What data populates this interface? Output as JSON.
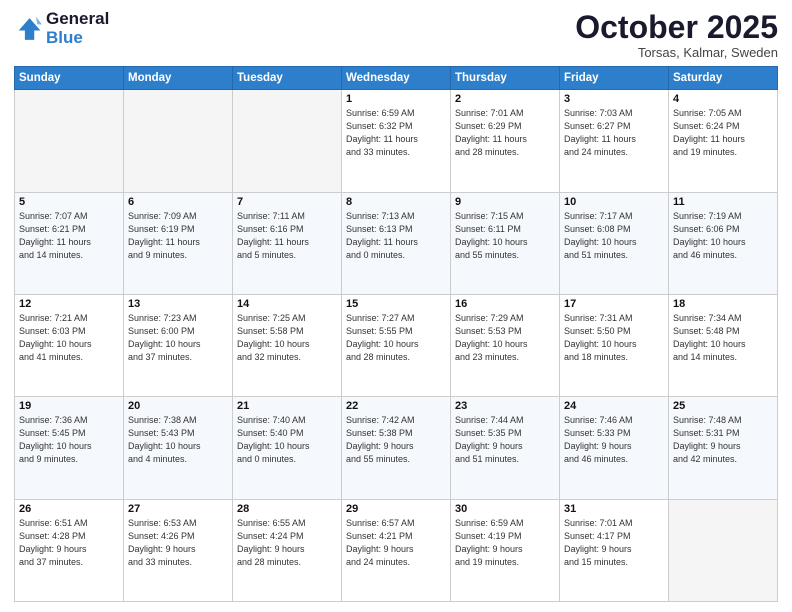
{
  "header": {
    "logo_line1": "General",
    "logo_line2": "Blue",
    "month": "October 2025",
    "location": "Torsas, Kalmar, Sweden"
  },
  "weekdays": [
    "Sunday",
    "Monday",
    "Tuesday",
    "Wednesday",
    "Thursday",
    "Friday",
    "Saturday"
  ],
  "weeks": [
    [
      {
        "day": "",
        "info": ""
      },
      {
        "day": "",
        "info": ""
      },
      {
        "day": "",
        "info": ""
      },
      {
        "day": "1",
        "info": "Sunrise: 6:59 AM\nSunset: 6:32 PM\nDaylight: 11 hours\nand 33 minutes."
      },
      {
        "day": "2",
        "info": "Sunrise: 7:01 AM\nSunset: 6:29 PM\nDaylight: 11 hours\nand 28 minutes."
      },
      {
        "day": "3",
        "info": "Sunrise: 7:03 AM\nSunset: 6:27 PM\nDaylight: 11 hours\nand 24 minutes."
      },
      {
        "day": "4",
        "info": "Sunrise: 7:05 AM\nSunset: 6:24 PM\nDaylight: 11 hours\nand 19 minutes."
      }
    ],
    [
      {
        "day": "5",
        "info": "Sunrise: 7:07 AM\nSunset: 6:21 PM\nDaylight: 11 hours\nand 14 minutes."
      },
      {
        "day": "6",
        "info": "Sunrise: 7:09 AM\nSunset: 6:19 PM\nDaylight: 11 hours\nand 9 minutes."
      },
      {
        "day": "7",
        "info": "Sunrise: 7:11 AM\nSunset: 6:16 PM\nDaylight: 11 hours\nand 5 minutes."
      },
      {
        "day": "8",
        "info": "Sunrise: 7:13 AM\nSunset: 6:13 PM\nDaylight: 11 hours\nand 0 minutes."
      },
      {
        "day": "9",
        "info": "Sunrise: 7:15 AM\nSunset: 6:11 PM\nDaylight: 10 hours\nand 55 minutes."
      },
      {
        "day": "10",
        "info": "Sunrise: 7:17 AM\nSunset: 6:08 PM\nDaylight: 10 hours\nand 51 minutes."
      },
      {
        "day": "11",
        "info": "Sunrise: 7:19 AM\nSunset: 6:06 PM\nDaylight: 10 hours\nand 46 minutes."
      }
    ],
    [
      {
        "day": "12",
        "info": "Sunrise: 7:21 AM\nSunset: 6:03 PM\nDaylight: 10 hours\nand 41 minutes."
      },
      {
        "day": "13",
        "info": "Sunrise: 7:23 AM\nSunset: 6:00 PM\nDaylight: 10 hours\nand 37 minutes."
      },
      {
        "day": "14",
        "info": "Sunrise: 7:25 AM\nSunset: 5:58 PM\nDaylight: 10 hours\nand 32 minutes."
      },
      {
        "day": "15",
        "info": "Sunrise: 7:27 AM\nSunset: 5:55 PM\nDaylight: 10 hours\nand 28 minutes."
      },
      {
        "day": "16",
        "info": "Sunrise: 7:29 AM\nSunset: 5:53 PM\nDaylight: 10 hours\nand 23 minutes."
      },
      {
        "day": "17",
        "info": "Sunrise: 7:31 AM\nSunset: 5:50 PM\nDaylight: 10 hours\nand 18 minutes."
      },
      {
        "day": "18",
        "info": "Sunrise: 7:34 AM\nSunset: 5:48 PM\nDaylight: 10 hours\nand 14 minutes."
      }
    ],
    [
      {
        "day": "19",
        "info": "Sunrise: 7:36 AM\nSunset: 5:45 PM\nDaylight: 10 hours\nand 9 minutes."
      },
      {
        "day": "20",
        "info": "Sunrise: 7:38 AM\nSunset: 5:43 PM\nDaylight: 10 hours\nand 4 minutes."
      },
      {
        "day": "21",
        "info": "Sunrise: 7:40 AM\nSunset: 5:40 PM\nDaylight: 10 hours\nand 0 minutes."
      },
      {
        "day": "22",
        "info": "Sunrise: 7:42 AM\nSunset: 5:38 PM\nDaylight: 9 hours\nand 55 minutes."
      },
      {
        "day": "23",
        "info": "Sunrise: 7:44 AM\nSunset: 5:35 PM\nDaylight: 9 hours\nand 51 minutes."
      },
      {
        "day": "24",
        "info": "Sunrise: 7:46 AM\nSunset: 5:33 PM\nDaylight: 9 hours\nand 46 minutes."
      },
      {
        "day": "25",
        "info": "Sunrise: 7:48 AM\nSunset: 5:31 PM\nDaylight: 9 hours\nand 42 minutes."
      }
    ],
    [
      {
        "day": "26",
        "info": "Sunrise: 6:51 AM\nSunset: 4:28 PM\nDaylight: 9 hours\nand 37 minutes."
      },
      {
        "day": "27",
        "info": "Sunrise: 6:53 AM\nSunset: 4:26 PM\nDaylight: 9 hours\nand 33 minutes."
      },
      {
        "day": "28",
        "info": "Sunrise: 6:55 AM\nSunset: 4:24 PM\nDaylight: 9 hours\nand 28 minutes."
      },
      {
        "day": "29",
        "info": "Sunrise: 6:57 AM\nSunset: 4:21 PM\nDaylight: 9 hours\nand 24 minutes."
      },
      {
        "day": "30",
        "info": "Sunrise: 6:59 AM\nSunset: 4:19 PM\nDaylight: 9 hours\nand 19 minutes."
      },
      {
        "day": "31",
        "info": "Sunrise: 7:01 AM\nSunset: 4:17 PM\nDaylight: 9 hours\nand 15 minutes."
      },
      {
        "day": "",
        "info": ""
      }
    ]
  ]
}
